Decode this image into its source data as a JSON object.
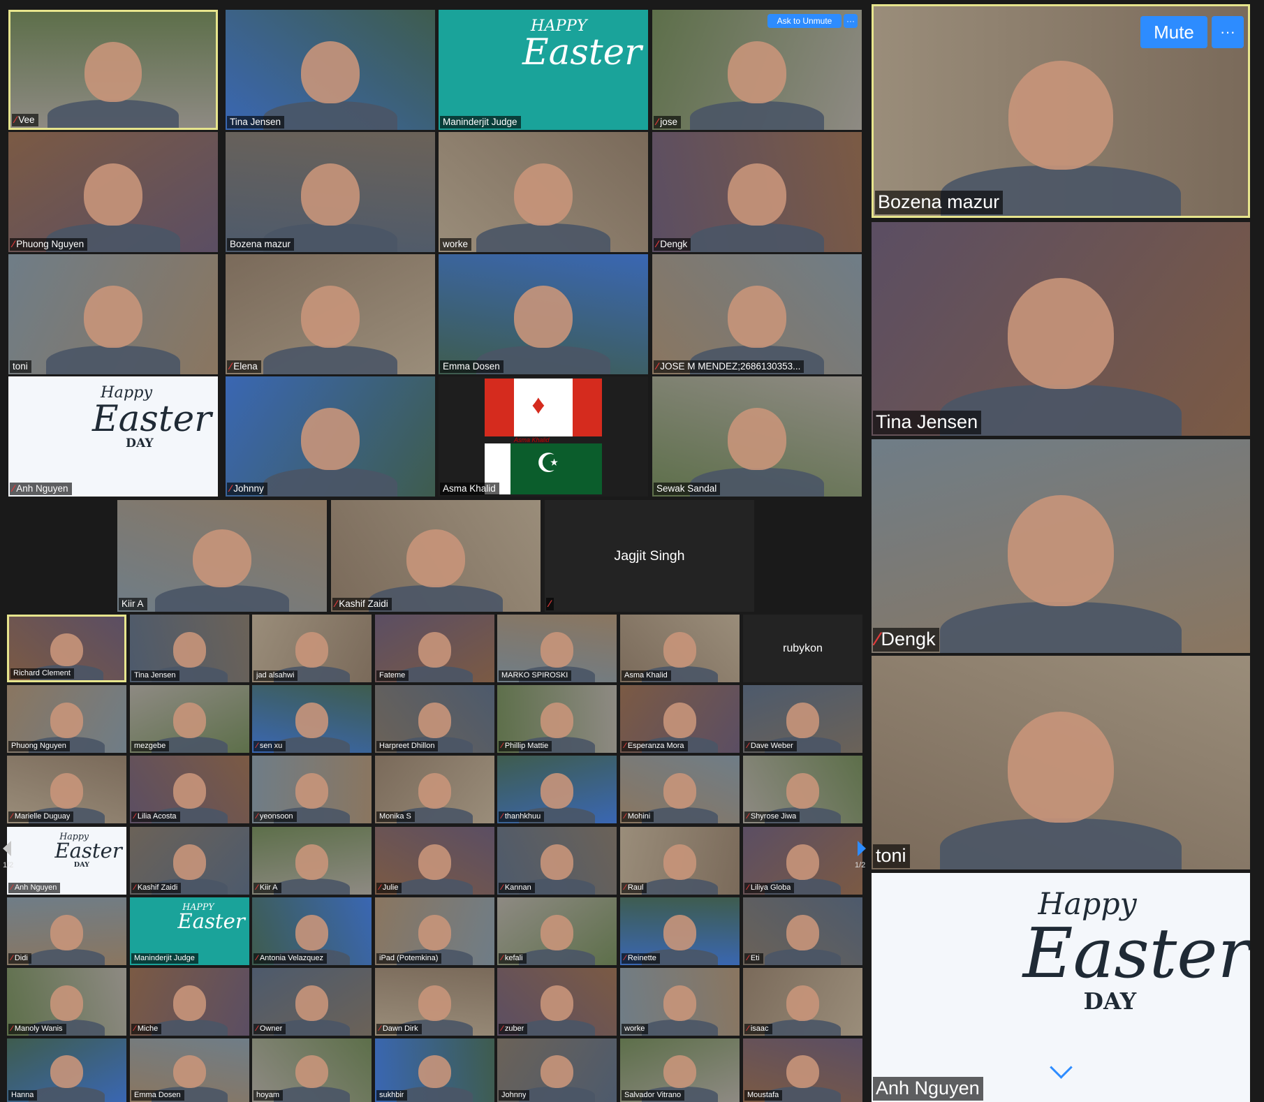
{
  "colors": {
    "background": "#1a1a1a",
    "active_border": "#e7e58d",
    "accent": "#2d8cff",
    "muted_icon": "#e03a3a"
  },
  "top_tiles": [
    {
      "name": "Vee",
      "muted": true,
      "active": true
    },
    {
      "name": "Tina Jensen",
      "muted": false
    },
    {
      "name": "Maninderjit Judge",
      "muted": false,
      "background_text": {
        "line1": "HAPPY",
        "line2": "Easter"
      }
    },
    {
      "name": "jose",
      "muted": true
    },
    {
      "name": "Phuong Nguyen",
      "muted": true
    },
    {
      "name": "Bozena mazur",
      "muted": false
    },
    {
      "name": "worke",
      "muted": false
    },
    {
      "name": "Dengk",
      "muted": true
    },
    {
      "name": "toni",
      "muted": false
    },
    {
      "name": "Elena",
      "muted": true
    },
    {
      "name": "Emma Dosen",
      "muted": false
    },
    {
      "name": "JOSE M MENDEZ;2686130353...",
      "muted": true
    },
    {
      "name": "Anh Nguyen",
      "muted": true,
      "background_text": {
        "line1": "Happy",
        "line2": "Easter",
        "line3": "DAY"
      }
    },
    {
      "name": "Johnny",
      "muted": true
    },
    {
      "name": "Asma Khalid",
      "muted": false,
      "flag_text": "Asma Khalid"
    },
    {
      "name": "Sewak Sandal",
      "muted": false
    }
  ],
  "middle_tiles": [
    {
      "name": "Kiir A",
      "muted": false
    },
    {
      "name": "Kashif Zaidi",
      "muted": true
    },
    {
      "name": "Jagjit Singh",
      "muted": true,
      "name_only": true
    }
  ],
  "ask_to_unmute": "Ask to Unmute",
  "more_label": "···",
  "gallery": [
    {
      "name": "Richard Clement",
      "muted": false,
      "active": true
    },
    {
      "name": "Tina Jensen",
      "muted": false
    },
    {
      "name": "jad alsahwi",
      "muted": false
    },
    {
      "name": "Fateme",
      "muted": false
    },
    {
      "name": "MARKO SPIROSKI",
      "muted": false
    },
    {
      "name": "Asma Khalid",
      "muted": false
    },
    {
      "name": "rubykon",
      "muted": false,
      "name_only": true
    },
    {
      "name": "Phuong Nguyen",
      "muted": false
    },
    {
      "name": "mezgebe",
      "muted": false
    },
    {
      "name": "sen xu",
      "muted": true
    },
    {
      "name": "Harpreet Dhillon",
      "muted": false
    },
    {
      "name": "Phillip Mattie",
      "muted": true
    },
    {
      "name": "Esperanza Mora",
      "muted": true
    },
    {
      "name": "Dave Weber",
      "muted": true
    },
    {
      "name": "Marielle Duguay",
      "muted": true
    },
    {
      "name": "Lilia Acosta",
      "muted": true
    },
    {
      "name": "yeonsoon",
      "muted": true
    },
    {
      "name": "Monika S",
      "muted": false
    },
    {
      "name": "thanhkhuu",
      "muted": true
    },
    {
      "name": "Mohini",
      "muted": true
    },
    {
      "name": "Shyrose Jiwa",
      "muted": true
    },
    {
      "name": "Anh Nguyen",
      "muted": true,
      "background_text": {
        "line1": "Happy",
        "line2": "Easter",
        "line3": "DAY"
      }
    },
    {
      "name": "Kashif Zaidi",
      "muted": true
    },
    {
      "name": "Kiir A",
      "muted": true
    },
    {
      "name": "Julie",
      "muted": true
    },
    {
      "name": "Kannan",
      "muted": true
    },
    {
      "name": "Raul",
      "muted": true
    },
    {
      "name": "Liliya Globa",
      "muted": true
    },
    {
      "name": "Didi",
      "muted": true
    },
    {
      "name": "Maninderjit Judge",
      "muted": false,
      "background_text": {
        "line1": "HAPPY",
        "line2": "Easter"
      }
    },
    {
      "name": "Antonia Velazquez",
      "muted": true
    },
    {
      "name": "iPad (Potemkina)",
      "muted": false
    },
    {
      "name": "kefali",
      "muted": true
    },
    {
      "name": "Reinette",
      "muted": true
    },
    {
      "name": "Eti",
      "muted": true
    },
    {
      "name": "Manoly Wanis",
      "muted": true
    },
    {
      "name": "Miche",
      "muted": true
    },
    {
      "name": "Owner",
      "muted": true
    },
    {
      "name": "Dawn Dirk",
      "muted": true
    },
    {
      "name": "zuber",
      "muted": true
    },
    {
      "name": "worke",
      "muted": false
    },
    {
      "name": "isaac",
      "muted": true
    },
    {
      "name": "Hanna",
      "muted": false
    },
    {
      "name": "Emma Dosen",
      "muted": false
    },
    {
      "name": "hoyam",
      "muted": false
    },
    {
      "name": "sukhbir",
      "muted": false
    },
    {
      "name": "Johnny",
      "muted": false
    },
    {
      "name": "Salvador Vitrano",
      "muted": false
    },
    {
      "name": "Moustafa",
      "muted": false
    }
  ],
  "pagination": {
    "left": "1/2",
    "right": "1/2"
  },
  "right_panel": {
    "mute_label": "Mute",
    "more_label": "···",
    "tiles": [
      {
        "name": "Bozena mazur",
        "muted": false,
        "active": true
      },
      {
        "name": "Tina Jensen",
        "muted": false
      },
      {
        "name": "Dengk",
        "muted": true
      },
      {
        "name": "toni",
        "muted": false
      },
      {
        "name": "Anh Nguyen",
        "muted": false,
        "background_text": {
          "line1": "Happy",
          "line2": "Easter",
          "line3": "DAY"
        }
      }
    ]
  }
}
